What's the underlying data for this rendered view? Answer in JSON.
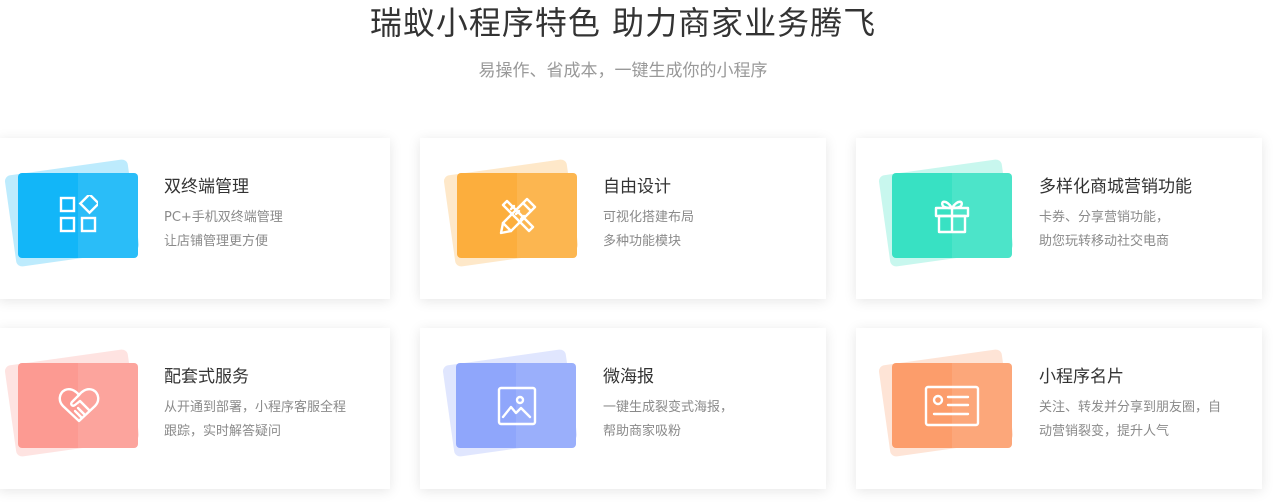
{
  "header": {
    "title": "瑞蚁小程序特色 助力商家业务腾飞",
    "subtitle": "易操作、省成本，一键生成你的小程序"
  },
  "features": [
    {
      "title": "双终端管理",
      "line1": "PC+手机双终端管理",
      "line2": "让店铺管理更方便",
      "icon": "apps-grid-icon",
      "color": "#12b6f8"
    },
    {
      "title": "自由设计",
      "line1": "可视化搭建布局",
      "line2": "多种功能模块",
      "icon": "pencil-ruler-icon",
      "color": "#fcae3d"
    },
    {
      "title": "多样化商城营销功能",
      "line1": "卡券、分享营销功能，",
      "line2": "助您玩转移动社交电商",
      "icon": "gift-icon",
      "color": "#38e1c3"
    },
    {
      "title": "配套式服务",
      "line1": "从开通到部署，小程序客服全程",
      "line2": "跟踪，实时解答疑问",
      "icon": "heart-handshake-icon",
      "color": "#fc9a92"
    },
    {
      "title": "微海报",
      "line1": "一键生成裂变式海报，",
      "line2": "帮助商家吸粉",
      "icon": "image-poster-icon",
      "color": "#8fa6fb"
    },
    {
      "title": "小程序名片",
      "line1": "关注、转发并分享到朋友圈，自",
      "line2": "动营销裂变，提升人气",
      "icon": "id-card-icon",
      "color": "#fc9d6b"
    }
  ]
}
